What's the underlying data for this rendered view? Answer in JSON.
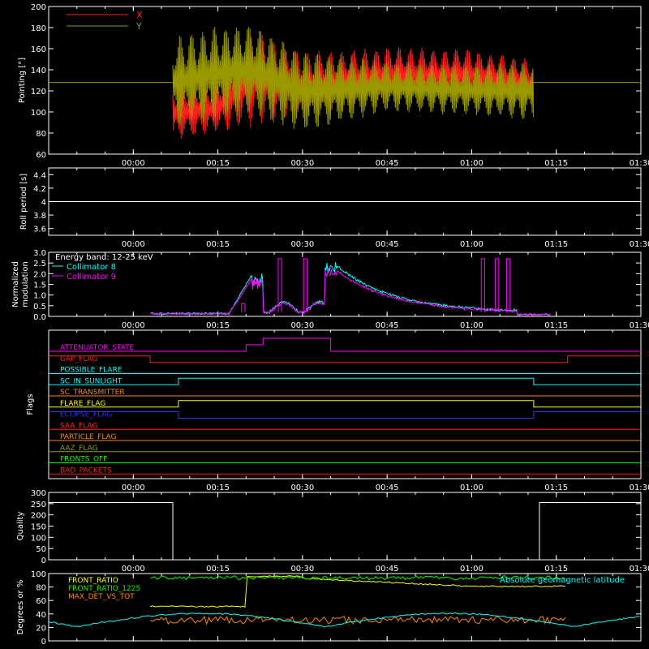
{
  "chart_data": [
    {
      "id": "pointing",
      "type": "line",
      "ylabel": "Pointing [°]",
      "ylim": [
        60,
        200
      ],
      "yticks": [
        60,
        80,
        100,
        120,
        140,
        160,
        180,
        200
      ],
      "xlim_minutes": [
        -15,
        90
      ],
      "xticks": [
        "00:00",
        "00:15",
        "00:30",
        "00:45",
        "01:00",
        "01:15",
        "01:30"
      ],
      "series": [
        {
          "name": "X",
          "color": "#ff2020",
          "envelope_time": [
            "00:07",
            "00:15",
            "00:21",
            "00:30",
            "00:45",
            "01:00",
            "01:11"
          ],
          "upper": [
            125,
            128,
            178,
            158,
            162,
            160,
            150
          ],
          "lower": [
            72,
            80,
            85,
            92,
            108,
            110,
            105
          ]
        },
        {
          "name": "Y",
          "color": "#999900",
          "envelope_time": [
            "00:07",
            "00:15",
            "00:21",
            "00:30",
            "00:45",
            "01:00",
            "01:11"
          ],
          "upper": [
            172,
            182,
            186,
            158,
            148,
            145,
            148
          ],
          "lower": [
            85,
            92,
            95,
            80,
            100,
            96,
            92
          ]
        }
      ],
      "baseline": 128,
      "grid": false,
      "legend": "top-left"
    },
    {
      "id": "roll",
      "type": "line",
      "ylabel": "Roll period [s]",
      "ylim": [
        3.5,
        4.5
      ],
      "yticks": [
        3.6,
        3.8,
        4.0,
        4.2,
        4.4
      ],
      "xticks": [
        "00:00",
        "00:15",
        "00:30",
        "00:45",
        "01:00",
        "01:15",
        "01:30"
      ],
      "series": [
        {
          "name": "",
          "color": "#ffffff",
          "values": [
            4.0
          ]
        }
      ]
    },
    {
      "id": "modulation",
      "type": "line",
      "ylabel": "Normalized modulation",
      "ylim": [
        0,
        3.0
      ],
      "yticks": [
        "0.0",
        "0.5",
        "1.0",
        "1.5",
        "2.0",
        "2.5",
        "3.0"
      ],
      "xticks": [
        "00:00",
        "00:15",
        "00:30",
        "00:45",
        "01:00",
        "01:15",
        "01:30"
      ],
      "legend_title": "Energy band: 12-25 keV",
      "series": [
        {
          "name": "Collimator 8",
          "color": "#00ffff"
        },
        {
          "name": "Collimator 9",
          "color": "#ff00ff"
        }
      ]
    },
    {
      "id": "flags",
      "type": "line",
      "ylabel": "Flags",
      "xticks": [
        "00:00",
        "00:15",
        "00:30",
        "00:45",
        "01:00",
        "01:15",
        "01:30"
      ],
      "flags": [
        {
          "name": "ATTENUATOR_STATE",
          "color": "#ff00ff"
        },
        {
          "name": "GAP_FLAG",
          "color": "#ff2020"
        },
        {
          "name": "POSSIBLE_FLARE",
          "color": "#00ffff"
        },
        {
          "name": "SC_IN_SUNLIGHT",
          "color": "#00ffff"
        },
        {
          "name": "SC_TRANSMITTER",
          "color": "#ff8800"
        },
        {
          "name": "FLARE_FLAG",
          "color": "#ffff00"
        },
        {
          "name": "ECLIPSE_FLAG",
          "color": "#3333ff"
        },
        {
          "name": "SAA_FLAG",
          "color": "#ff2020"
        },
        {
          "name": "PARTICLE_FLAG",
          "color": "#ff8800"
        },
        {
          "name": "AAZ_FLAG",
          "color": "#999900"
        },
        {
          "name": "FRONTS_OFF",
          "color": "#00ff00"
        },
        {
          "name": "BAD_PACKETS",
          "color": "#ff2020"
        }
      ]
    },
    {
      "id": "quality",
      "type": "line",
      "ylabel": "Quality",
      "ylim": [
        0,
        300
      ],
      "yticks": [
        0,
        50,
        100,
        150,
        200,
        250,
        300
      ],
      "xticks": [
        "00:00",
        "00:15",
        "00:30",
        "00:45",
        "01:00",
        "01:15",
        "01:30"
      ],
      "series": [
        {
          "name": "",
          "color": "#ffffff",
          "time": [
            "-00:15",
            "00:07",
            "00:07",
            "01:12",
            "01:12",
            "01:30"
          ],
          "values": [
            255,
            255,
            0,
            0,
            255,
            255
          ]
        }
      ]
    },
    {
      "id": "degrees",
      "type": "line",
      "ylabel": "Degrees or %",
      "ylim": [
        0,
        100
      ],
      "yticks": [
        0,
        20,
        40,
        60,
        80,
        100
      ],
      "series": [
        {
          "name": "FRONT_RATIO",
          "color": "#ffff00"
        },
        {
          "name": "FRONT_RATIO_1225",
          "color": "#00ff00"
        },
        {
          "name": "MAX_DET_VS_TOT",
          "color": "#ff8800"
        },
        {
          "name": "Absolute geomagnetic latitude",
          "color": "#00ffff"
        }
      ]
    }
  ],
  "colors": {
    "background": "#000000",
    "axes": "#ffffff"
  }
}
